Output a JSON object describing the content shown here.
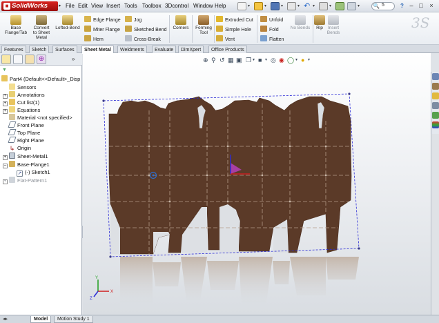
{
  "app": {
    "name": "SolidWorks"
  },
  "menu": [
    "File",
    "Edit",
    "View",
    "Insert",
    "Tools",
    "Toolbox",
    "3Dcontrol",
    "Window",
    "Help"
  ],
  "search": {
    "value": "5"
  },
  "ribbon": {
    "base_flange": "Base\nFlange/Tab",
    "convert": "Convert\nto Sheet\nMetal",
    "lofted_bend": "Lofted-Bend",
    "edge_flange": "Edge Flange",
    "miter_flange": "Miter Flange",
    "hem": "Hem",
    "jog": "Jog",
    "sketched_bend": "Sketched Bend",
    "cross_break": "Cross-Break",
    "corners": "Corners",
    "forming_tool": "Forming\nTool",
    "extruded_cut": "Extruded Cut",
    "simple_hole": "Simple Hole",
    "vent": "Vent",
    "unfold": "Unfold",
    "fold": "Fold",
    "flatten": "Flatten",
    "no_bends": "No Bends",
    "rip": "Rip",
    "insert_bends": "Insert\nBends"
  },
  "tabs": [
    "Features",
    "Sketch",
    "Surfaces",
    "Sheet Metal",
    "Weldments",
    "Evaluate",
    "DimXpert",
    "Office Products"
  ],
  "active_tab": "Sheet Metal",
  "tree": [
    {
      "label": "Part4  (Default<<Default>_Disp",
      "icon": "part-icon",
      "expander": ""
    },
    {
      "label": "Sensors",
      "icon": "sensors-icon",
      "expander": ""
    },
    {
      "label": "Annotations",
      "icon": "annotations-icon",
      "expander": "+"
    },
    {
      "label": "Cut list(1)",
      "icon": "cut-list-icon",
      "expander": "+"
    },
    {
      "label": "Equations",
      "icon": "equations-icon",
      "expander": "+"
    },
    {
      "label": "Material <not specified>",
      "icon": "material-icon",
      "expander": ""
    },
    {
      "label": "Front Plane",
      "icon": "plane-icon",
      "expander": ""
    },
    {
      "label": "Top Plane",
      "icon": "plane-icon",
      "expander": ""
    },
    {
      "label": "Right Plane",
      "icon": "plane-icon",
      "expander": ""
    },
    {
      "label": "Origin",
      "icon": "origin-icon",
      "expander": ""
    },
    {
      "label": "Sheet-Metal1",
      "icon": "sheet-metal-icon",
      "expander": "+"
    },
    {
      "label": "Base-Flange1",
      "icon": "base-flange-icon",
      "expander": "-"
    },
    {
      "label": "(-) Sketch1",
      "icon": "sketch-icon",
      "expander": ""
    },
    {
      "label": "Flat-Pattern1",
      "icon": "flat-pattern-icon",
      "expander": "+"
    }
  ],
  "bottom_tabs": [
    "Model",
    "Motion Study 1"
  ],
  "colors": {
    "part": "#5b3a28",
    "selection": "#2b2bd6",
    "accent_red": "#c8201c"
  }
}
